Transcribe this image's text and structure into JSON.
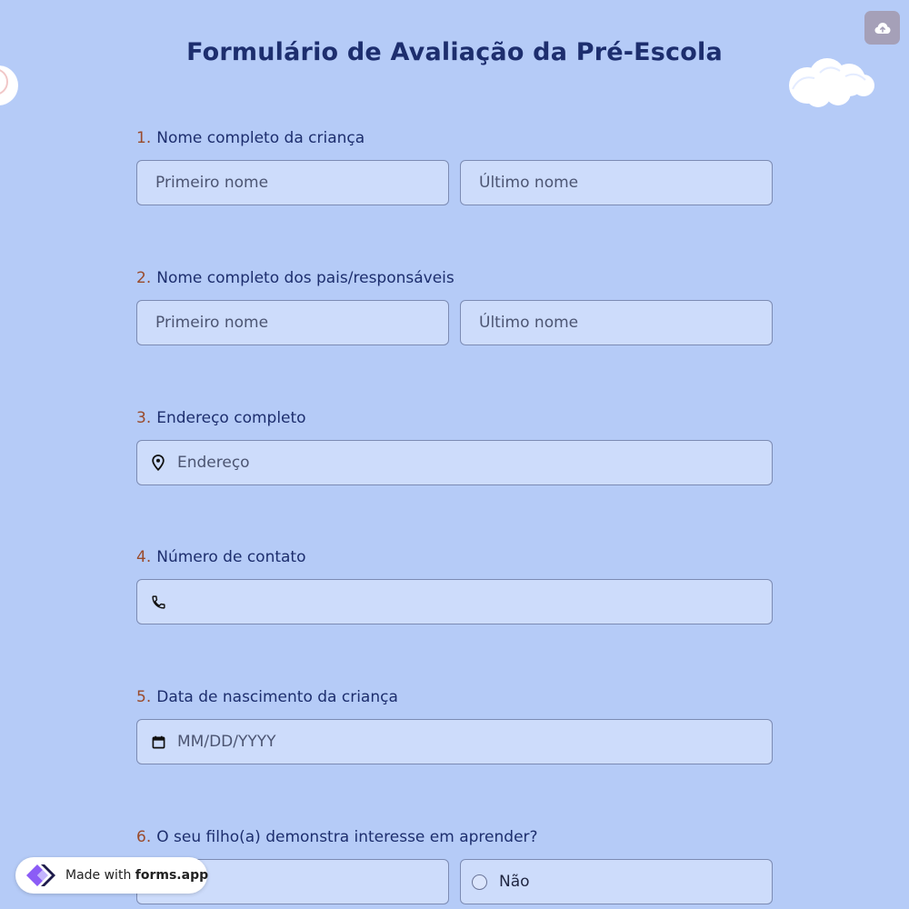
{
  "form": {
    "title": "Formulário de Avaliação da Pré-Escola"
  },
  "questions": [
    {
      "number": "1.",
      "label": "Nome completo da criança",
      "first_placeholder": "Primeiro nome",
      "last_placeholder": "Último nome"
    },
    {
      "number": "2.",
      "label": "Nome completo dos pais/responsáveis",
      "first_placeholder": "Primeiro nome",
      "last_placeholder": "Último nome"
    },
    {
      "number": "3.",
      "label": "Endereço completo",
      "placeholder": "Endereço",
      "icon": "location-pin-icon"
    },
    {
      "number": "4.",
      "label": "Número de contato",
      "placeholder": "",
      "icon": "phone-icon"
    },
    {
      "number": "5.",
      "label": "Data de nascimento da criança",
      "placeholder": "MM/DD/YYYY",
      "icon": "calendar-icon"
    },
    {
      "number": "6.",
      "label": "O seu filho(a) demonstra interesse em aprender?",
      "options": [
        "",
        "Não"
      ]
    }
  ],
  "badge": {
    "made_with": "Made with",
    "brand": "forms.app"
  },
  "colors": {
    "background": "#b5cbf7",
    "field_fill": "#cddcfb",
    "field_border": "#7c8bb3",
    "title": "#1d2e6e",
    "number": "#9a4b2c",
    "upload_button": "#a5a0b8"
  },
  "icons": {
    "upload": "cloud-upload-icon",
    "logo": "forms-app-logo-icon"
  }
}
